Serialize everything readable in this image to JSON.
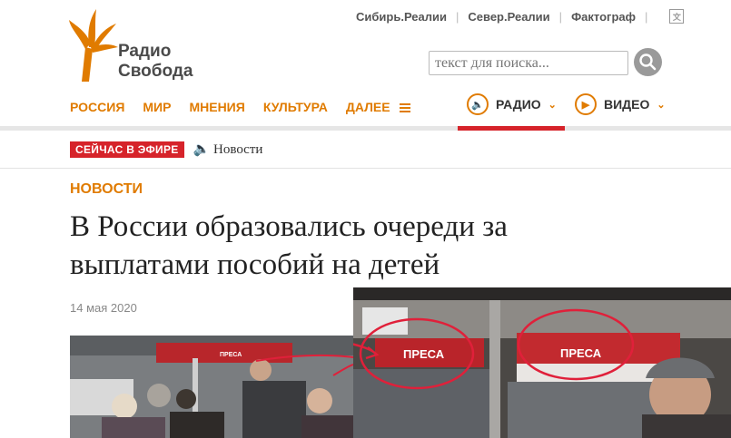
{
  "logo": {
    "line1": "Радио",
    "line2": "Свобода"
  },
  "sister_sites": [
    "Сибирь.Реалии",
    "Север.Реалии",
    "Фактограф"
  ],
  "search": {
    "placeholder": "текст для поиска..."
  },
  "nav": {
    "items": [
      "РОССИЯ",
      "МИР",
      "МНЕНИЯ",
      "КУЛЬТУРА",
      "ДАЛЕЕ"
    ]
  },
  "media": {
    "radio": "РАДИО",
    "video": "ВИДЕО"
  },
  "on_air": {
    "badge": "СЕЙЧАС В ЭФИРЕ",
    "program": "Новости"
  },
  "article": {
    "section": "НОВОСТИ",
    "headline": "В России образовались очереди за выплатами пособий на детей",
    "date": "14 мая 2020"
  },
  "photo": {
    "sign_left": "ПРЕСА",
    "sign_right": "ПРЕСА"
  },
  "colors": {
    "accent": "#e07b00",
    "live_red": "#d6232a",
    "annotation_red": "#e0203a"
  }
}
